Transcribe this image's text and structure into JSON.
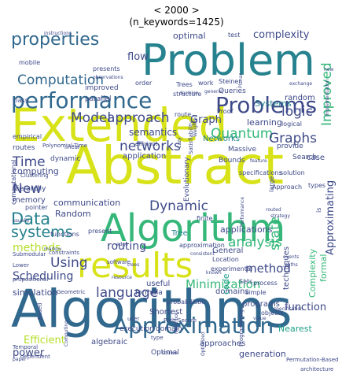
{
  "title_line1": "< 2000 >",
  "title_line2": "(n_keywords=1425)",
  "colors": {
    "teal": "#26828e",
    "blue": "#31688e",
    "indigo": "#3e4a89",
    "purple": "#482878",
    "green": "#35b779",
    "lime": "#b5de2b",
    "yellow": "#d8e219",
    "aqua": "#1f9e89",
    "sea": "#6ece58"
  },
  "words": [
    {
      "text": "Algorithms",
      "color": "blue"
    },
    {
      "text": "Abstract",
      "color": "yellow"
    },
    {
      "text": "Extended",
      "color": "yellow"
    },
    {
      "text": "Algorithm",
      "color": "green"
    },
    {
      "text": "Problem",
      "color": "teal"
    },
    {
      "text": "results",
      "color": "yellow"
    },
    {
      "text": "performance",
      "color": "blue"
    },
    {
      "text": "Problems",
      "color": "indigo"
    },
    {
      "text": "Approximation",
      "color": "blue"
    },
    {
      "text": "properties",
      "color": "blue"
    },
    {
      "text": "Computation",
      "color": "blue"
    },
    {
      "text": "approach",
      "color": "indigo"
    },
    {
      "text": "Model",
      "color": "indigo"
    },
    {
      "text": "Data",
      "color": "teal"
    },
    {
      "text": "systems",
      "color": "teal"
    },
    {
      "text": "Using",
      "color": "indigo"
    },
    {
      "text": "Dynamic",
      "color": "indigo"
    },
    {
      "text": "networks",
      "color": "indigo"
    },
    {
      "text": "Quantum",
      "color": "green"
    },
    {
      "text": "Graphs",
      "color": "indigo"
    },
    {
      "text": "logic",
      "color": "indigo"
    },
    {
      "text": "Improved",
      "color": "green"
    },
    {
      "text": "state",
      "color": "green"
    },
    {
      "text": "analysis",
      "color": "green"
    },
    {
      "text": "language",
      "color": "indigo"
    },
    {
      "text": "routing",
      "color": "indigo"
    },
    {
      "text": "Minimization",
      "color": "green"
    },
    {
      "text": "methods",
      "color": "lime"
    },
    {
      "text": "Scheduling",
      "color": "indigo"
    },
    {
      "text": "method",
      "color": "indigo"
    },
    {
      "text": "Time",
      "color": "indigo"
    },
    {
      "text": "New",
      "color": "indigo"
    },
    {
      "text": "complexity",
      "color": "indigo"
    },
    {
      "text": "Approximating",
      "color": "indigo"
    },
    {
      "text": "function",
      "color": "indigo"
    },
    {
      "text": "Efficient",
      "color": "lime"
    },
    {
      "text": "power",
      "color": "indigo"
    },
    {
      "text": "simulation",
      "color": "indigo"
    },
    {
      "text": "Random",
      "color": "indigo"
    },
    {
      "text": "applications",
      "color": "indigo"
    },
    {
      "text": "Graph",
      "color": "indigo"
    },
    {
      "text": "semantics",
      "color": "indigo"
    },
    {
      "text": "learning",
      "color": "indigo"
    },
    {
      "text": "Systems",
      "color": "teal"
    },
    {
      "text": "computing",
      "color": "indigo"
    },
    {
      "text": "optimal",
      "color": "indigo"
    },
    {
      "text": "flow",
      "color": "indigo"
    },
    {
      "text": "random",
      "color": "indigo"
    },
    {
      "text": "communication",
      "color": "indigo"
    },
    {
      "text": "application",
      "color": "indigo"
    },
    {
      "text": "General",
      "color": "indigo"
    },
    {
      "text": "domains",
      "color": "indigo"
    },
    {
      "text": "programs",
      "color": "indigo"
    },
    {
      "text": "techniques",
      "color": "indigo"
    },
    {
      "text": "code",
      "color": "aqua"
    },
    {
      "text": "generation",
      "color": "indigo"
    },
    {
      "text": "approaches",
      "color": "indigo"
    },
    {
      "text": "Optimal",
      "color": "indigo"
    },
    {
      "text": "algebraic",
      "color": "indigo"
    },
    {
      "text": "Nearest",
      "color": "aqua"
    },
    {
      "text": "Networks",
      "color": "teal"
    },
    {
      "text": "memory",
      "color": "indigo"
    },
    {
      "text": "hierarchy",
      "color": "indigo"
    },
    {
      "text": "Tree",
      "color": "teal"
    },
    {
      "text": "case",
      "color": "indigo"
    },
    {
      "text": "formula",
      "color": "indigo"
    },
    {
      "text": "useful",
      "color": "indigo"
    },
    {
      "text": "execution",
      "color": "indigo"
    },
    {
      "text": "domain",
      "color": "indigo"
    },
    {
      "text": "Shortest",
      "color": "indigo"
    },
    {
      "text": "Massive",
      "color": "indigo"
    },
    {
      "text": "Search",
      "color": "indigo"
    },
    {
      "text": "provide",
      "color": "indigo"
    },
    {
      "text": "Bounds",
      "color": "indigo"
    },
    {
      "text": "specifications",
      "color": "indigo"
    },
    {
      "text": "routes",
      "color": "indigo"
    },
    {
      "text": "empirical",
      "color": "indigo"
    },
    {
      "text": "dynamic",
      "color": "indigo"
    },
    {
      "text": "improved",
      "color": "indigo"
    },
    {
      "text": "parallel",
      "color": "indigo"
    },
    {
      "text": "mobile",
      "color": "indigo"
    },
    {
      "text": "order",
      "color": "indigo"
    },
    {
      "text": "test",
      "color": "indigo"
    },
    {
      "text": "Queries",
      "color": "indigo"
    },
    {
      "text": "Steiner",
      "color": "indigo"
    },
    {
      "text": "presents",
      "color": "indigo"
    },
    {
      "text": "Proof",
      "color": "indigo"
    },
    {
      "text": "route",
      "color": "indigo"
    },
    {
      "text": "logical",
      "color": "indigo"
    },
    {
      "text": "solution",
      "color": "indigo"
    },
    {
      "text": "Approach",
      "color": "indigo"
    },
    {
      "text": "Location",
      "color": "indigo"
    },
    {
      "text": "finite",
      "color": "indigo"
    },
    {
      "text": "approximation",
      "color": "indigo"
    },
    {
      "text": "experimental",
      "color": "indigo"
    },
    {
      "text": "software",
      "color": "indigo"
    },
    {
      "text": "present",
      "color": "indigo"
    },
    {
      "text": "functions",
      "color": "indigo"
    },
    {
      "text": "pointer",
      "color": "indigo"
    },
    {
      "text": "Evolutionary",
      "color": "indigo"
    },
    {
      "text": "Sets",
      "color": "indigo"
    },
    {
      "text": "probabilistic",
      "color": "indigo"
    },
    {
      "text": "simple",
      "color": "indigo"
    },
    {
      "text": "process",
      "color": "indigo"
    },
    {
      "text": "objects",
      "color": "indigo"
    },
    {
      "text": "Complexity",
      "color": "green"
    },
    {
      "text": "formal",
      "color": "green"
    },
    {
      "text": "is",
      "color": "indigo"
    },
    {
      "text": "types",
      "color": "indigo"
    },
    {
      "text": "structure",
      "color": "indigo"
    },
    {
      "text": "Trees",
      "color": "indigo"
    },
    {
      "text": "work",
      "color": "indigo"
    },
    {
      "text": "class",
      "color": "indigo"
    },
    {
      "text": "computational",
      "color": "indigo"
    },
    {
      "text": "Polynomial-Time",
      "color": "indigo"
    },
    {
      "text": "Clustering",
      "color": "indigo"
    },
    {
      "text": "linear",
      "color": "indigo"
    },
    {
      "text": "efficient",
      "color": "indigo"
    },
    {
      "text": "large",
      "color": "indigo"
    },
    {
      "text": "Lower",
      "color": "indigo"
    },
    {
      "text": "Submodular",
      "color": "indigo"
    },
    {
      "text": "constraints",
      "color": "indigo"
    },
    {
      "text": "propositional",
      "color": "indigo"
    },
    {
      "text": "Temporal",
      "color": "indigo"
    },
    {
      "text": "dependent",
      "color": "indigo"
    },
    {
      "text": "Geometric",
      "color": "indigo"
    },
    {
      "text": "Based",
      "color": "indigo"
    },
    {
      "text": "Secure",
      "color": "indigo"
    },
    {
      "text": "Path",
      "color": "indigo"
    },
    {
      "text": "user",
      "color": "indigo"
    },
    {
      "text": "type",
      "color": "indigo"
    },
    {
      "text": "Programming",
      "color": "indigo"
    },
    {
      "text": "architecture",
      "color": "indigo"
    },
    {
      "text": "Permutation-Based",
      "color": "indigo"
    },
    {
      "text": "Satisfiability",
      "color": "indigo"
    },
    {
      "text": "instructions",
      "color": "indigo"
    },
    {
      "text": "observations",
      "color": "indigo"
    },
    {
      "text": "Implementation",
      "color": "indigo"
    },
    {
      "text": "exchange",
      "color": "indigo"
    },
    {
      "text": "decision",
      "color": "indigo"
    },
    {
      "text": "feature",
      "color": "indigo"
    },
    {
      "text": "Performance",
      "color": "indigo"
    },
    {
      "text": "routed",
      "color": "indigo"
    },
    {
      "text": "strategy",
      "color": "indigo"
    },
    {
      "text": "events",
      "color": "indigo"
    },
    {
      "text": "paths",
      "color": "indigo"
    },
    {
      "text": "value",
      "color": "indigo"
    },
    {
      "text": "markov",
      "color": "indigo"
    },
    {
      "text": "edge",
      "color": "indigo"
    },
    {
      "text": "trees",
      "color": "indigo"
    },
    {
      "text": "source",
      "color": "indigo"
    },
    {
      "text": "Computing",
      "color": "indigo"
    },
    {
      "text": "Neighbor",
      "color": "indigo"
    },
    {
      "text": "usually",
      "color": "indigo"
    },
    {
      "text": "known",
      "color": "indigo"
    },
    {
      "text": "consistent",
      "color": "indigo"
    },
    {
      "text": "specification",
      "color": "indigo"
    },
    {
      "text": "new",
      "color": "indigo"
    },
    {
      "text": "Planar",
      "color": "indigo"
    },
    {
      "text": "general",
      "color": "indigo"
    },
    {
      "text": "resource",
      "color": "indigo"
    },
    {
      "text": "Lazy",
      "color": "indigo"
    },
    {
      "text": "Weighted",
      "color": "indigo"
    },
    {
      "text": "paper",
      "color": "indigo"
    },
    {
      "text": "Optimized",
      "color": "indigo"
    }
  ]
}
